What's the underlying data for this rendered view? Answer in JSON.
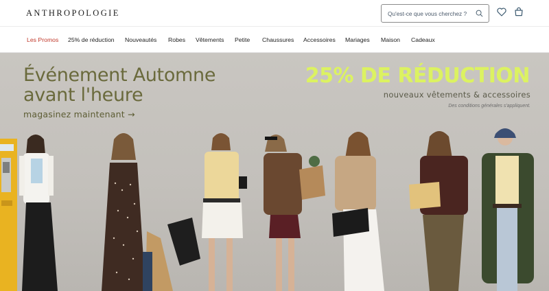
{
  "header": {
    "logo": "ANTHROPOLOGIE",
    "search_placeholder": "Qu'est-ce que vous cherchez ?",
    "search_icon": "search-icon",
    "wishlist_icon": "heart-icon",
    "cart_icon": "shopping-bag-icon"
  },
  "nav": {
    "items": [
      {
        "label": "Les Promos"
      },
      {
        "label": "25% de réduction"
      },
      {
        "label": "Nouveautés"
      },
      {
        "label": "Robes"
      },
      {
        "label": "Vêtements"
      },
      {
        "label": "Petite"
      },
      {
        "label": "Chaussures"
      },
      {
        "label": "Accessoires"
      },
      {
        "label": "Mariages"
      },
      {
        "label": "Maison"
      },
      {
        "label": "Cadeaux"
      }
    ],
    "promo_color": "#c0392b"
  },
  "hero": {
    "title_line1": "Événement Automne",
    "title_line2": "avant l'heure",
    "cta": "magasinez maintenant →",
    "promo_headline": "25% DE RÉDUCTION",
    "promo_subline": "nouveaux vêtements & accessoires",
    "promo_terms": "Des conditions générales s'appliquent.",
    "title_color": "#6a6a3c",
    "promo_color": "#dcf261"
  }
}
